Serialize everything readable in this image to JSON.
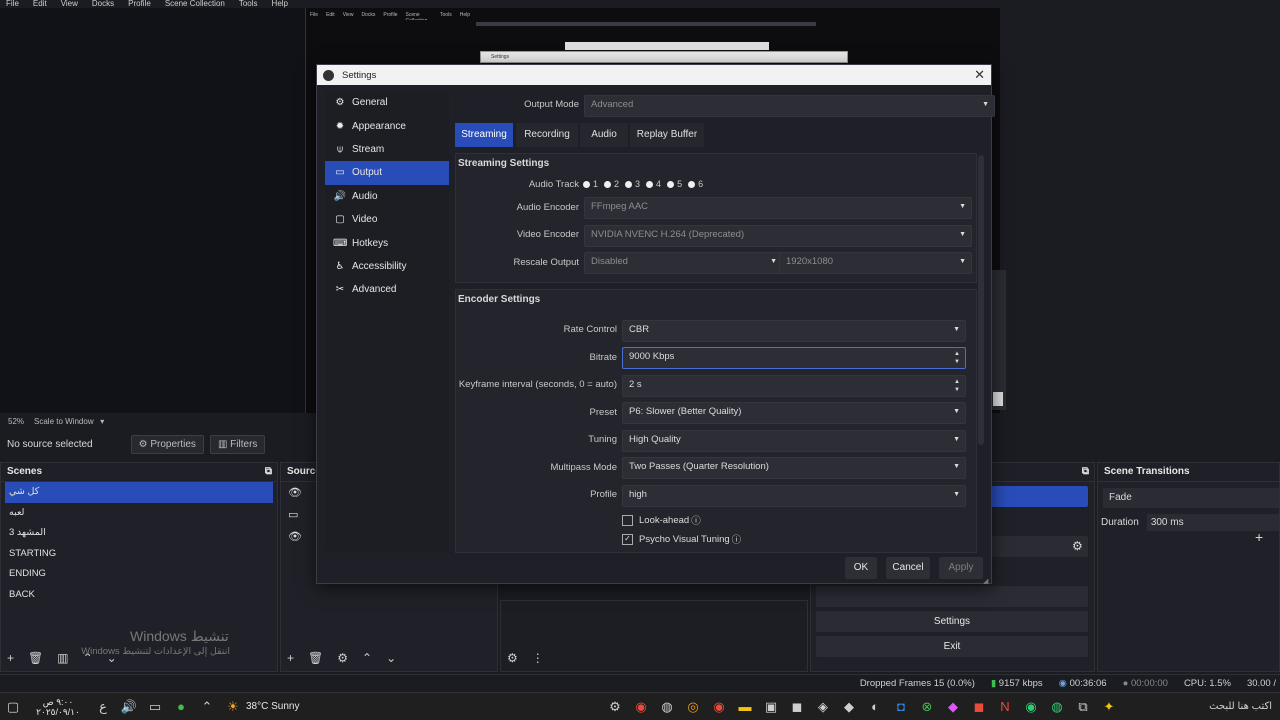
{
  "menubar": [
    "File",
    "Edit",
    "View",
    "Docks",
    "Profile",
    "Scene Collection",
    "Tools",
    "Help"
  ],
  "nested_menubar": [
    "File",
    "Edit",
    "View",
    "Docks",
    "Profile",
    "Scene Collection",
    "Tools",
    "Help"
  ],
  "nested_window_title": "Settings",
  "zoom": {
    "percent": "52%",
    "mode": "Scale to Window"
  },
  "sourcebar": {
    "no_source": "No source selected",
    "properties": "Properties",
    "filters": "Filters"
  },
  "scenes": {
    "title": "Scenes",
    "items": [
      "كل شي",
      "لعبه",
      "المشهد 3",
      "STARTING",
      "ENDING",
      "BACK"
    ],
    "selected_index": 0
  },
  "sources": {
    "title": "Source"
  },
  "controls": {
    "settings": "Settings",
    "exit": "Exit"
  },
  "transitions": {
    "title": "Scene Transitions",
    "value": "Fade",
    "duration_label": "Duration",
    "duration_value": "300 ms"
  },
  "watermark": {
    "line1": "Windows تنشيط",
    "line2": "انتقل إلى الإعدادات لتنشيط Windows"
  },
  "status": {
    "dropped": "Dropped Frames 15 (0.0%)",
    "bitrate": "9157 kbps",
    "live_time": "00:36:06",
    "rec_time": "00:00:00",
    "cpu": "CPU: 1.5%",
    "fps": "30.00 /"
  },
  "taskbar": {
    "clock_time": "٩:٠٠ ص",
    "clock_date": "٢٠٢٥/٠٩/١٠",
    "lang": "ع",
    "weather": "38°C  Sunny",
    "search": "اكتب هنا للبحث"
  },
  "dialog": {
    "title": "Settings",
    "nav": [
      {
        "label": "General",
        "icon": "gear-icon",
        "glyph": "⚙"
      },
      {
        "label": "Appearance",
        "icon": "palette-icon",
        "glyph": "✹"
      },
      {
        "label": "Stream",
        "icon": "antenna-icon",
        "glyph": "⍦"
      },
      {
        "label": "Output",
        "icon": "output-icon",
        "glyph": "▭"
      },
      {
        "label": "Audio",
        "icon": "speaker-icon",
        "glyph": "🔊"
      },
      {
        "label": "Video",
        "icon": "monitor-icon",
        "glyph": "▢"
      },
      {
        "label": "Hotkeys",
        "icon": "keyboard-icon",
        "glyph": "⌨"
      },
      {
        "label": "Accessibility",
        "icon": "accessibility-icon",
        "glyph": "♿"
      },
      {
        "label": "Advanced",
        "icon": "wrench-icon",
        "glyph": "✂"
      }
    ],
    "nav_selected": 3,
    "output_mode_label": "Output Mode",
    "output_mode_value": "Advanced",
    "tabs": [
      "Streaming",
      "Recording",
      "Audio",
      "Replay Buffer"
    ],
    "tab_selected": 0,
    "streaming_settings": {
      "title": "Streaming Settings",
      "audio_track_label": "Audio Track",
      "tracks": [
        "1",
        "2",
        "3",
        "4",
        "5",
        "6"
      ],
      "audio_encoder_label": "Audio Encoder",
      "audio_encoder_value": "FFmpeg AAC",
      "video_encoder_label": "Video Encoder",
      "video_encoder_value": "NVIDIA NVENC H.264 (Deprecated)",
      "rescale_label": "Rescale Output",
      "rescale_value": "Disabled",
      "rescale_res": "1920x1080"
    },
    "encoder_settings": {
      "title": "Encoder Settings",
      "rate_control_label": "Rate Control",
      "rate_control_value": "CBR",
      "bitrate_label": "Bitrate",
      "bitrate_value": "9000 Kbps",
      "keyframe_label": "Keyframe interval (seconds, 0 = auto)",
      "keyframe_value": "2 s",
      "preset_label": "Preset",
      "preset_value": "P6: Slower (Better Quality)",
      "tuning_label": "Tuning",
      "tuning_value": "High Quality",
      "multipass_label": "Multipass Mode",
      "multipass_value": "Two Passes (Quarter Resolution)",
      "profile_label": "Profile",
      "profile_value": "high",
      "lookahead_label": "Look-ahead",
      "lookahead_checked": false,
      "psycho_label": "Psycho Visual Tuning",
      "psycho_checked": true
    },
    "buttons": {
      "ok": "OK",
      "cancel": "Cancel",
      "apply": "Apply"
    }
  }
}
